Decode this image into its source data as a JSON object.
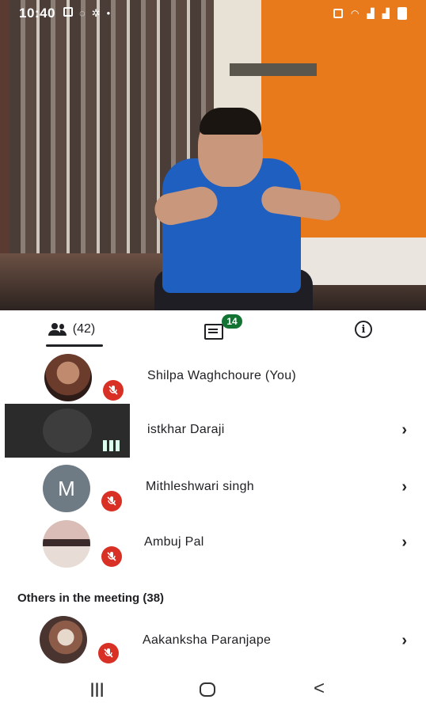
{
  "status_bar": {
    "time": "10:40",
    "left_icons": [
      "image-icon",
      "chat-bubble-icon",
      "settings-icon",
      "dot-icon"
    ],
    "right_icons": [
      "cast-icon",
      "wifi-icon",
      "signal-icon",
      "signal-icon",
      "battery-icon"
    ]
  },
  "tabs": {
    "people_label": "(42)",
    "chat_badge": "14",
    "info_label": "i",
    "active": "people"
  },
  "participants": [
    {
      "name": "Shilpa Waghchoure (You)",
      "avatar": "photo",
      "muted": true,
      "has_chevron": false
    },
    {
      "name": "istkhar Daraji",
      "avatar": "video-tile",
      "muted": false,
      "speaking": true,
      "has_chevron": true
    },
    {
      "name": "Mithleshwari singh",
      "avatar": "initial",
      "initial": "M",
      "muted": true,
      "has_chevron": true
    },
    {
      "name": "Ambuj Pal",
      "avatar": "photo",
      "muted": true,
      "has_chevron": true
    }
  ],
  "others_section": {
    "label": "Others in the meeting (38)"
  },
  "others": [
    {
      "name": "Aakanksha Paranjape",
      "avatar": "photo",
      "muted": true,
      "has_chevron": true
    }
  ],
  "colors": {
    "mute_red": "#d93025",
    "chat_badge_green": "#137333",
    "panel_bg": "#ffffff",
    "text": "#202124"
  },
  "nav": {
    "recent_label": "|||",
    "back_label": "<"
  }
}
